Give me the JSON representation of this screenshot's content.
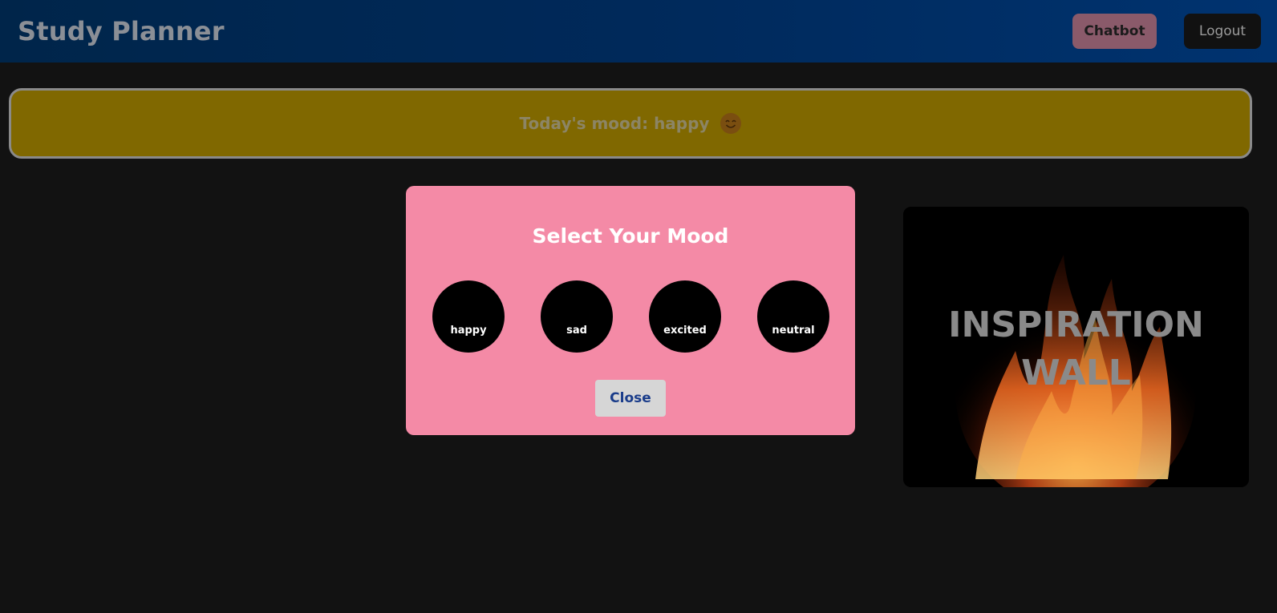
{
  "header": {
    "brand": "Study Planner",
    "chatbot_label": "Chatbot",
    "logout_label": "Logout"
  },
  "mood_banner": {
    "text": "Today's mood: happy",
    "emoji": "😊"
  },
  "modal": {
    "title": "Select Your Mood",
    "options": [
      {
        "label": "happy",
        "emoji": "😊"
      },
      {
        "label": "sad",
        "emoji": "😢"
      },
      {
        "label": "excited",
        "emoji": "😀"
      },
      {
        "label": "neutral",
        "emoji": "😐"
      }
    ],
    "close_label": "Close"
  },
  "inspiration": {
    "title": "INSPIRATION\nWALL"
  },
  "colors": {
    "navbar": "#00295a",
    "banner": "#806800",
    "modal": "#f48aa6",
    "mood_circle": "#000000"
  }
}
